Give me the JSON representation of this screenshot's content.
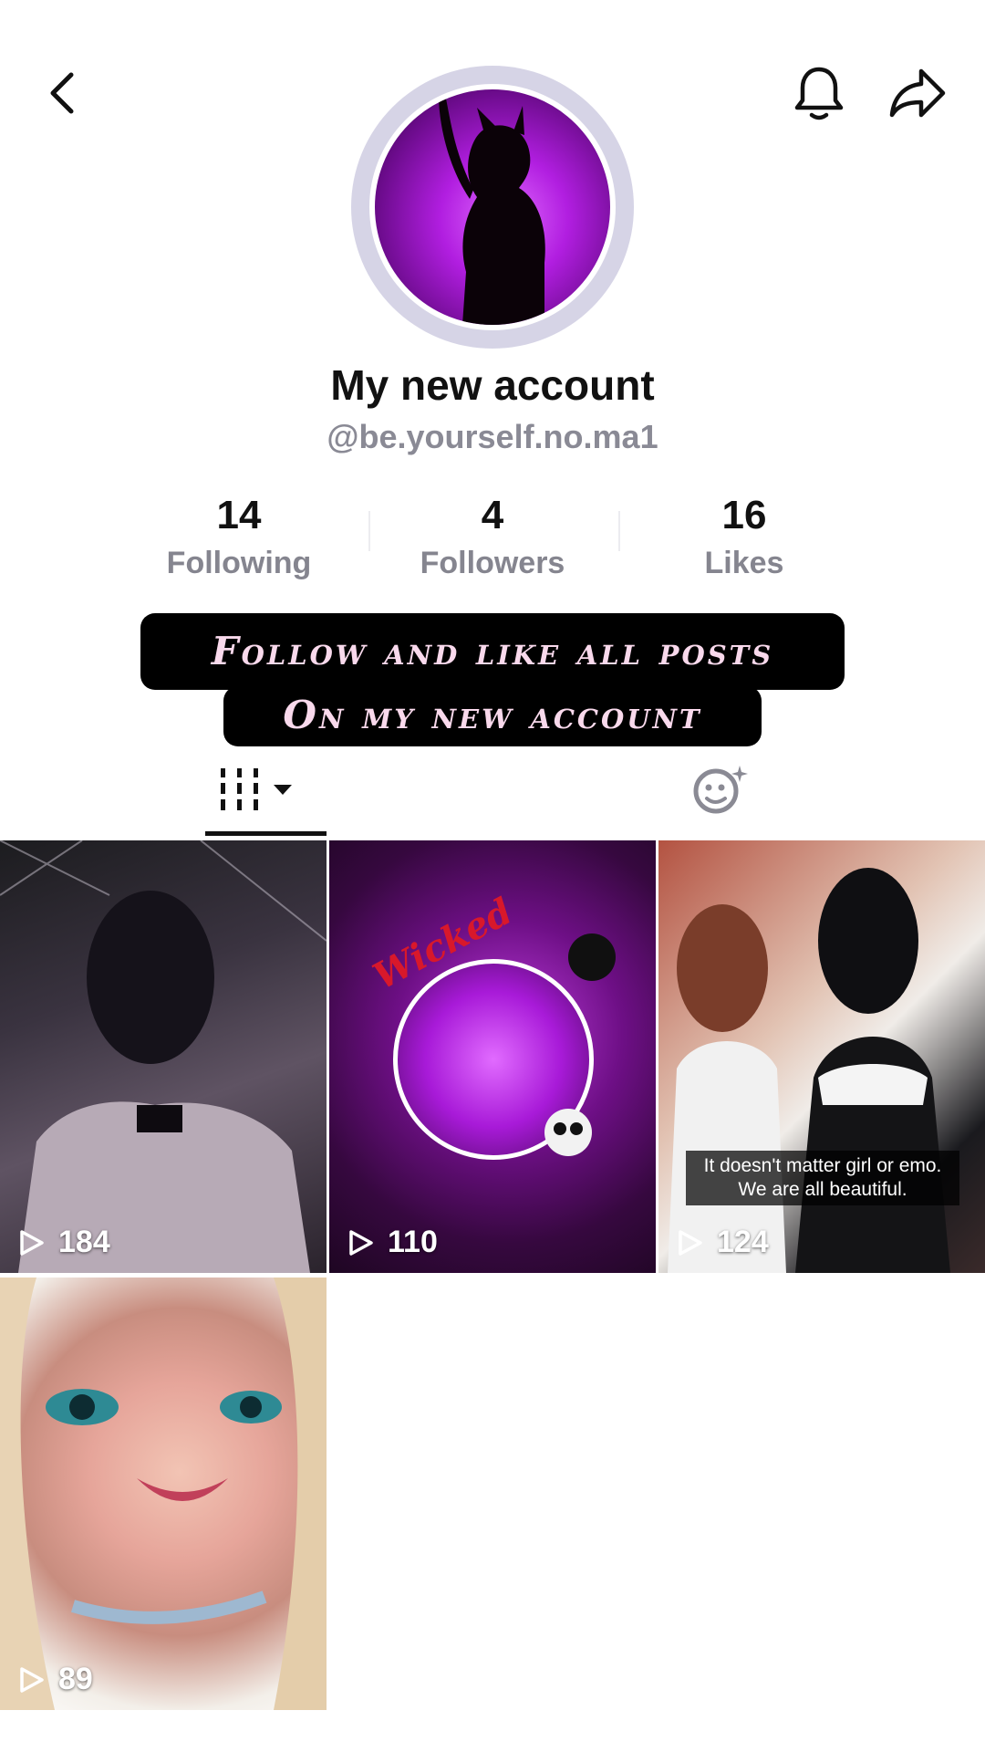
{
  "profile": {
    "display_name": "My new account",
    "handle": "@be.yourself.no.ma1"
  },
  "stats": {
    "following": {
      "value": "14",
      "label": "Following"
    },
    "followers": {
      "value": "4",
      "label": "Followers"
    },
    "likes": {
      "value": "16",
      "label": "Likes"
    }
  },
  "overlay": {
    "line1": "Follow and like all posts",
    "line2": "On my new account"
  },
  "icons": {
    "back": "chevron-left-icon",
    "notifications": "bell-icon",
    "share": "share-arrow-icon",
    "videos_tab": "grid-filter-icon",
    "liked_tab": "face-sparkle-icon"
  },
  "videos": [
    {
      "views": "184"
    },
    {
      "views": "110",
      "overlay_text": "Wicked"
    },
    {
      "views": "124",
      "caption": "It doesn't matter girl or emo. We are all beautiful."
    },
    {
      "views": "89"
    }
  ],
  "colors": {
    "accent_purple": "#b11ee0",
    "banner_text": "#f9d9ec",
    "muted_text": "#85858f"
  }
}
